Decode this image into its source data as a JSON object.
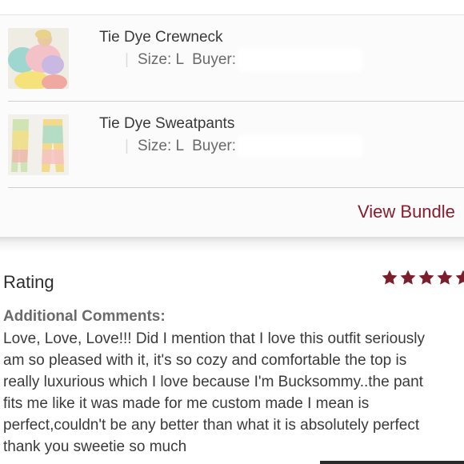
{
  "bundle": {
    "items": [
      {
        "title": "Tie Dye Crewneck",
        "size": "Size: L",
        "buyer_label": "Buyer:"
      },
      {
        "title": "Tie Dye Sweatpants",
        "size": "Size: L",
        "buyer_label": "Buyer:"
      }
    ],
    "view_bundle_label": "View Bundle"
  },
  "review": {
    "rating_label": "Rating",
    "rating_value": 5,
    "rating_max": 5,
    "star_color": "#7a1f2b",
    "comments_label": "Additional Comments:",
    "comment_lines": [
      "Love, Love, Love!!! Did I mention that I love this outfit seriously",
      "am so pleased with it, it's so cozy and comfortable the top is",
      "really luxurious which I love because I'm Bucksommy..the pant",
      "fits me like it was made for me custom made I mean is",
      "perfect,couldn't be any better than what it is absolutely perfect",
      "thank you sweetie so much"
    ]
  },
  "colors": {
    "accent": "#8a1c2c"
  }
}
